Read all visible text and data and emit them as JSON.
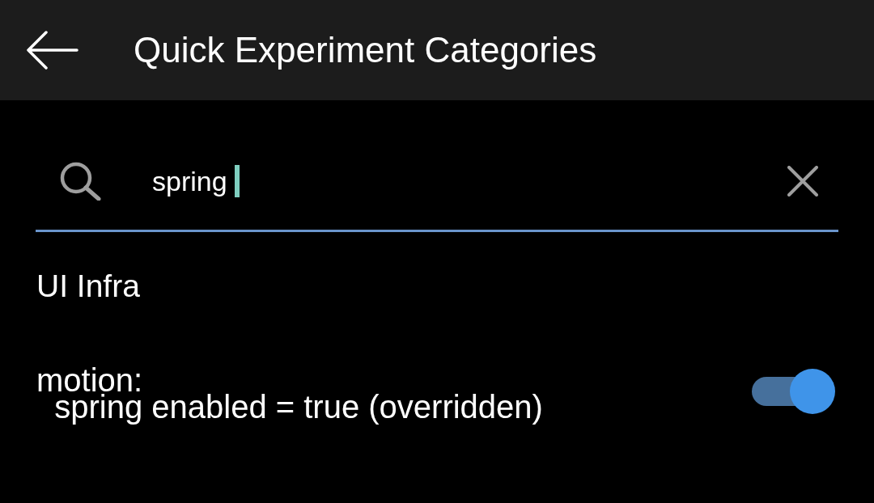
{
  "app_bar": {
    "title": "Quick Experiment Categories"
  },
  "search": {
    "value": "spring",
    "focused": true
  },
  "categories": [
    {
      "kind": "header",
      "label": "UI Infra"
    },
    {
      "kind": "toggle",
      "label": "motion:\n  spring enabled = true (overridden)",
      "on": true
    }
  ]
}
